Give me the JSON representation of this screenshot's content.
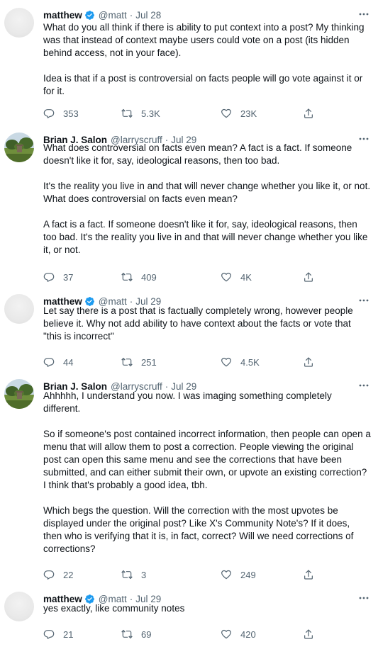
{
  "tweets": [
    {
      "name": "matthew",
      "verified": true,
      "handle": "@matt",
      "date": "Jul 28",
      "avatar": "matt",
      "paragraphs": [
        "What do you all think if there is ability to put context into a post? My thinking was that instead of context maybe users could vote on a post (its hidden behind access, not in your face).",
        "Idea is that if a post is controversial on facts people will go vote against it or for it."
      ],
      "replies": "353",
      "reposts": "5.3K",
      "likes": "23K"
    },
    {
      "name": "Brian J. Salon",
      "verified": false,
      "handle": "@larryscruff",
      "date": "Jul 29",
      "avatar": "brian",
      "paragraphs": [
        "What does controversial on facts even mean? A fact is a fact. If someone doesn't like it for, say, ideological reasons, then too bad.",
        "It's the reality you live in and that will never change whether you like it, or not. What does controversial on facts even mean?",
        "A fact is a fact. If someone doesn't like it for, say, ideological reasons, then too bad. It's the reality you live in and that will never change whether you like it, or not."
      ],
      "replies": "37",
      "reposts": "409",
      "likes": "4K"
    },
    {
      "name": "matthew",
      "verified": true,
      "handle": "@matt",
      "date": "Jul 29",
      "avatar": "matt",
      "paragraphs": [
        "Let say there is a post that is factually completely wrong, however people believe it. Why not add ability to have context about the facts or vote that \"this is incorrect\""
      ],
      "replies": "44",
      "reposts": "251",
      "likes": "4.5K"
    },
    {
      "name": "Brian J. Salon",
      "verified": false,
      "handle": "@larryscruff",
      "date": "Jul 29",
      "avatar": "brian",
      "paragraphs": [
        "Ahhhhh, I understand you now. I was imaging something completely different.",
        "So if someone's post contained incorrect information, then people can open a menu that will allow them to post a correction. People viewing the original post can open this same menu and see the corrections that have been submitted, and can either submit their own, or upvote an existing correction? I think that's probably a good idea, tbh.",
        "Which begs the question. Will the correction with the most upvotes be displayed under the original post? Like X's Community Note's? If it does, then who is verifying that it is, in fact, correct? Will we need corrections of corrections?"
      ],
      "replies": "22",
      "reposts": "3",
      "likes": "249"
    },
    {
      "name": "matthew",
      "verified": true,
      "handle": "@matt",
      "date": "Jul 29",
      "avatar": "matt",
      "paragraphs": [
        "yes exactly, like community notes"
      ],
      "replies": "21",
      "reposts": "69",
      "likes": "420"
    }
  ],
  "icons": {
    "reply": "reply-icon",
    "repost": "repost-icon",
    "like": "heart-icon",
    "share": "share-icon",
    "more": "more-icon",
    "verified": "verified-badge-icon"
  },
  "colors": {
    "text": "#0f1419",
    "secondary": "#536471",
    "verified": "#1d9bf0",
    "divider": "#eff3f4"
  }
}
